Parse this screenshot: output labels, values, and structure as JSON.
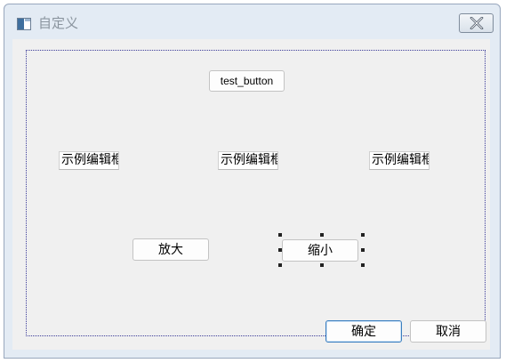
{
  "window": {
    "title": "自定义"
  },
  "form": {
    "test_button_label": "test_button",
    "edits": [
      {
        "value": "示例编辑框"
      },
      {
        "value": "示例编辑框"
      },
      {
        "value": "示例编辑框"
      }
    ],
    "zoom_in_label": "放大",
    "zoom_out_label": "缩小",
    "ok_label": "确定",
    "cancel_label": "取消"
  },
  "icons": {
    "window_icon": "window-icon",
    "close_icon": "close-icon"
  },
  "colors": {
    "title_text": "#8a949e",
    "frame": "#e3ebf4",
    "client_bg": "#f0f0f0",
    "selection_handles": "#222222",
    "default_button_border": "#3a7ebf"
  }
}
